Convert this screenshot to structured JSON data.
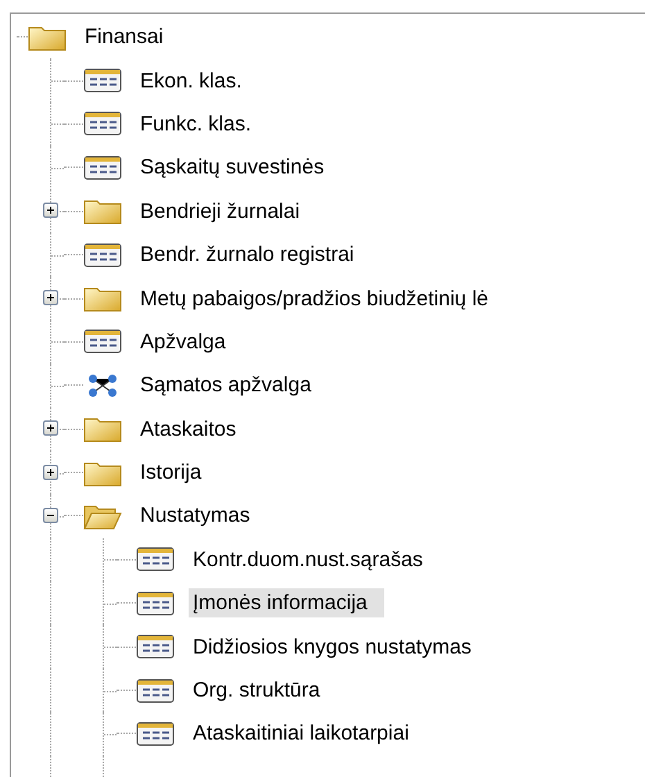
{
  "tree": [
    {
      "label": "Finansai",
      "kind": "folder",
      "selected": false,
      "children": [
        {
          "label": "Ekon. klas.",
          "kind": "form",
          "selected": false
        },
        {
          "label": "Funkc. klas.",
          "kind": "form",
          "selected": false
        },
        {
          "label": "Sąskaitų suvestinės",
          "kind": "form",
          "selected": false
        },
        {
          "label": "Bendrieji žurnalai",
          "kind": "folder",
          "selected": false,
          "expanded": false
        },
        {
          "label": "Bendr. žurnalo registrai",
          "kind": "form",
          "selected": false
        },
        {
          "label": "Metų pabaigos/pradžios biudžetinių lė",
          "kind": "folder",
          "selected": false,
          "expanded": false
        },
        {
          "label": "Apžvalga",
          "kind": "form",
          "selected": false
        },
        {
          "label": "Sąmatos apžvalga",
          "kind": "diagram",
          "selected": false
        },
        {
          "label": "Ataskaitos",
          "kind": "folder",
          "selected": false,
          "expanded": false
        },
        {
          "label": "Istorija",
          "kind": "folder",
          "selected": false,
          "expanded": false
        },
        {
          "label": "Nustatymas",
          "kind": "folder",
          "selected": false,
          "expanded": true,
          "children": [
            {
              "label": "Kontr.duom.nust.sąrašas",
              "kind": "form",
              "selected": false
            },
            {
              "label": "Įmonės informacija",
              "kind": "form",
              "selected": true
            },
            {
              "label": "Didžiosios knygos nustatymas",
              "kind": "form",
              "selected": false
            },
            {
              "label": "Org. struktūra",
              "kind": "form",
              "selected": false
            },
            {
              "label": "Ataskaitiniai laikotarpiai",
              "kind": "form",
              "selected": false
            }
          ]
        }
      ]
    }
  ]
}
